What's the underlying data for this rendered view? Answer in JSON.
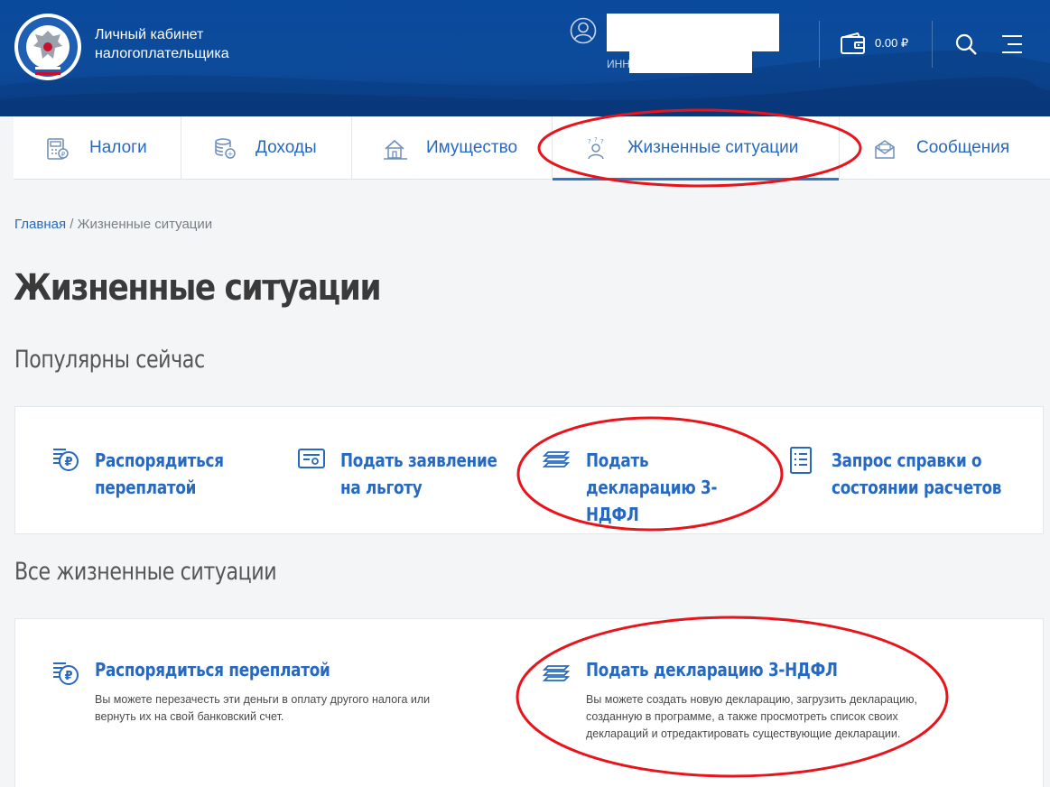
{
  "header": {
    "brand_line1": "Личный кабинет",
    "brand_line2": "налогоплательщика",
    "inn_label": "ИНН",
    "balance": "0.00 ₽"
  },
  "tabs": [
    {
      "label": "Налоги",
      "icon": "calculator-icon"
    },
    {
      "label": "Доходы",
      "icon": "coins-icon"
    },
    {
      "label": "Имущество",
      "icon": "house-icon"
    },
    {
      "label": "Жизненные ситуации",
      "icon": "person-question-icon",
      "active": true
    },
    {
      "label": "Сообщения",
      "icon": "envelope-icon"
    }
  ],
  "breadcrumb": {
    "home": "Главная",
    "separator": " / ",
    "current": "Жизненные ситуации"
  },
  "page_title": "Жизненные ситуации",
  "popular": {
    "title": "Популярны сейчас",
    "items": [
      {
        "label": "Распорядиться переплатой",
        "icon": "ruble-document-icon"
      },
      {
        "label": "Подать заявление на льготу",
        "icon": "certificate-icon"
      },
      {
        "label": "Подать декларацию 3-НДФЛ",
        "icon": "stack-papers-icon"
      },
      {
        "label": "Запрос справки о состоянии расчетов",
        "icon": "checklist-icon"
      }
    ]
  },
  "all": {
    "title": "Все жизненные ситуации",
    "items": [
      {
        "title": "Распорядиться переплатой",
        "desc": "Вы можете перезачесть эти деньги в оплату другого налога или вернуть их на свой банковский счет.",
        "icon": "ruble-document-icon"
      },
      {
        "title": "Подать декларацию 3-НДФЛ",
        "desc": "Вы можете создать новую декларацию, загрузить декларацию, созданную в программе, а также просмотреть список своих деклараций и отредактировать существующие декларации.",
        "icon": "stack-papers-icon"
      }
    ]
  },
  "colors": {
    "header": "#0d4a9a",
    "accent": "#2769c0",
    "annotation": "#e8141c"
  }
}
